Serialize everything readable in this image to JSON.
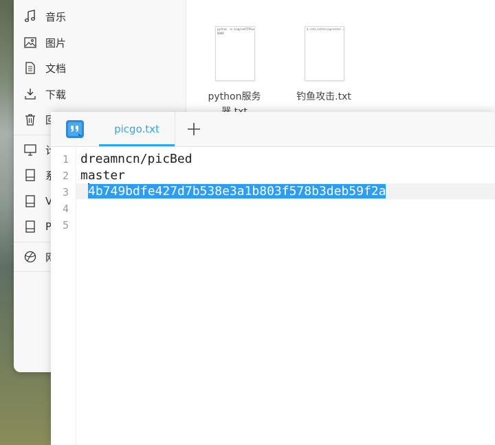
{
  "file_manager": {
    "sidebar": {
      "items": [
        {
          "icon": "music-note-icon",
          "label": "音乐"
        },
        {
          "icon": "image-icon",
          "label": "图片"
        },
        {
          "icon": "document-icon",
          "label": "文档"
        },
        {
          "icon": "download-icon",
          "label": "下载"
        },
        {
          "icon": "trash-icon",
          "label": "回"
        },
        {
          "icon": "computer-icon",
          "label": "计"
        },
        {
          "icon": "drive-icon",
          "label": "系"
        },
        {
          "icon": "drive-icon",
          "label": "V"
        },
        {
          "icon": "drive-icon",
          "label": "P"
        },
        {
          "icon": "network-icon",
          "label": "网"
        }
      ]
    },
    "files": [
      {
        "name_line1": "python服务",
        "name_line2": "器.txt",
        "preview_line1": "python -m SimpleHTTPServer",
        "preview_line2": "8888"
      },
      {
        "name_line1": "钓鱼攻击.txt",
        "name_line2": "",
        "preview_line1": "d:/etc/ettercap/etter.conf",
        "preview_line2": ""
      }
    ]
  },
  "editor": {
    "tab": {
      "label": "picgo.txt"
    },
    "add_tab_label": "+",
    "line_numbers": [
      "1",
      "2",
      "3",
      "4",
      "5"
    ],
    "lines": [
      "dreamncn/picBed",
      "master",
      "4b749bdfe427d7b538e3a1b803f578b3deb59f2a",
      "",
      ""
    ],
    "current_line": 3,
    "selection_color": "#2c9df5",
    "accent_color": "#2ca7f8"
  }
}
